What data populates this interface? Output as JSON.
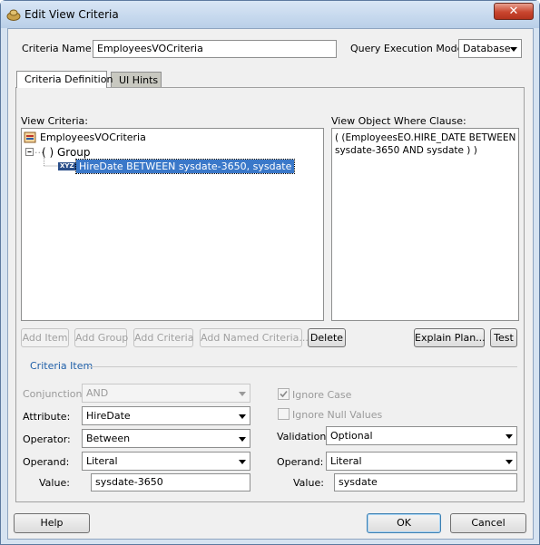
{
  "window": {
    "title": "Edit View Criteria",
    "close_label": "✕"
  },
  "criteria_name": {
    "label": "Criteria Name:",
    "value": "EmployeesVOCriteria"
  },
  "query_execution_mode": {
    "label": "Query Execution Mode:",
    "value": "Database"
  },
  "tabs": [
    {
      "label": "Criteria Definition",
      "selected": true
    },
    {
      "label": "UI Hints",
      "selected": false
    }
  ],
  "view_criteria": {
    "label": "View Criteria:",
    "tree": {
      "root": "EmployeesVOCriteria",
      "group": "( ) Group",
      "item_badge": "XYZ",
      "item": "HireDate BETWEEN sysdate-3650, sysdate"
    }
  },
  "where_clause": {
    "label": "View Object Where Clause:",
    "line1": "( (EmployeesEO.HIRE_DATE BETWEEN",
    "line2": "sysdate-3650  AND  sysdate ) )"
  },
  "toolbar": {
    "add_item": "Add Item",
    "add_group": "Add Group",
    "add_criteria": "Add Criteria",
    "add_named_criteria": "Add Named Criteria...",
    "delete": "Delete",
    "explain_plan": "Explain Plan...",
    "test": "Test"
  },
  "criteria_item": {
    "section_title": "Criteria Item",
    "conjunction": {
      "label": "Conjunction:",
      "value": "AND"
    },
    "attribute": {
      "label": "Attribute:",
      "value": "HireDate"
    },
    "operator": {
      "label": "Operator:",
      "value": "Between"
    },
    "operand_left": {
      "label": "Operand:",
      "value": "Literal"
    },
    "value_left": {
      "label": "Value:",
      "value": "sysdate-3650"
    },
    "ignore_case": {
      "label": "Ignore Case",
      "checked": true
    },
    "ignore_null_values": {
      "label": "Ignore Null Values",
      "checked": false
    },
    "validation": {
      "label": "Validation:",
      "value": "Optional"
    },
    "operand_right": {
      "label": "Operand:",
      "value": "Literal"
    },
    "value_right": {
      "label": "Value:",
      "value": "sysdate"
    }
  },
  "footer": {
    "help": "Help",
    "ok": "OK",
    "cancel": "Cancel"
  }
}
